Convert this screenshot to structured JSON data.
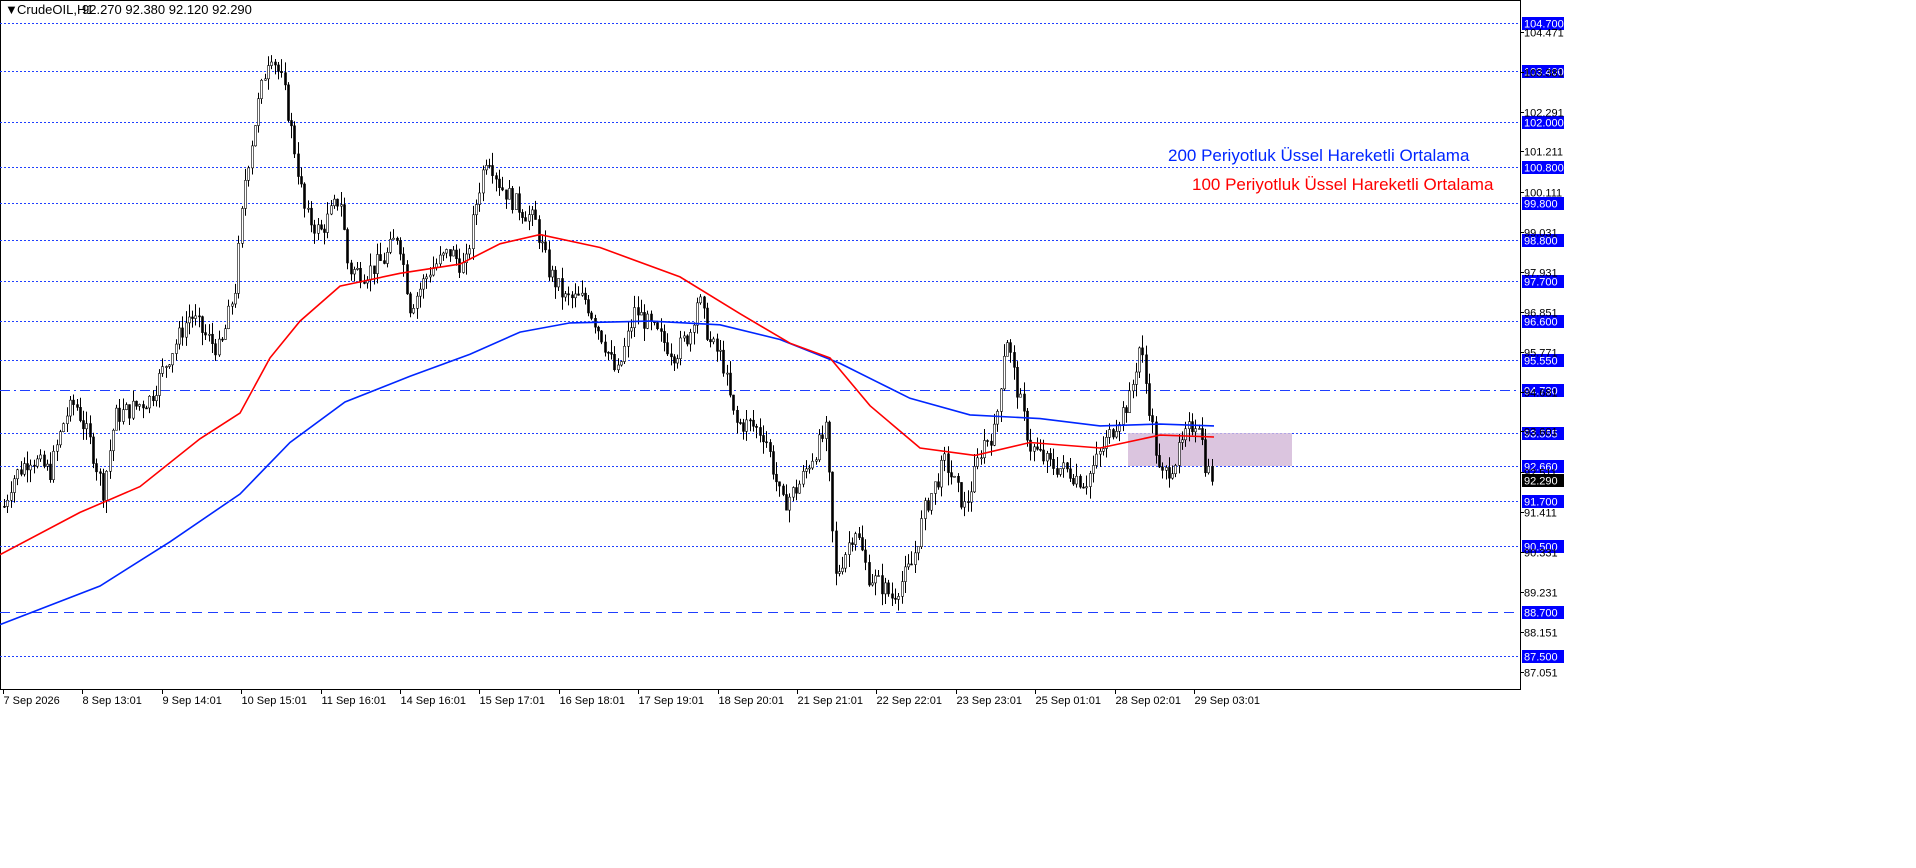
{
  "header": {
    "triangle": "▼",
    "symbol": "CrudeOIL,H1",
    "ohlc": "92.270 92.380 92.120 92.290"
  },
  "legend": {
    "ema200": "200 Periyotluk Üssel Hareketli Ortalama",
    "ema100": "100 Periyotluk Üssel Hareketli Ortalama"
  },
  "colors": {
    "background": "#ffffff",
    "candle": "#000000",
    "level_line": "#1f3fff",
    "level_label_bg": "#0000ff",
    "ema200": "#0026ff",
    "ema100": "#ff0000",
    "zone": "#d7bfdc",
    "current_price_bg": "#000000"
  },
  "chart_data": {
    "type": "candlestick",
    "symbol": "CrudeOIL",
    "timeframe": "H1",
    "ylim": [
      86.6,
      105.3
    ],
    "y_ticks": [
      "104.471",
      "103.381",
      "102.291",
      "101.211",
      "100.111",
      "99.031",
      "97.931",
      "96.851",
      "95.771",
      "94.681",
      "93.601",
      "92.511",
      "91.411",
      "90.331",
      "89.231",
      "88.151",
      "87.051"
    ],
    "x_ticks": [
      "7 Sep 2026",
      "8 Sep 13:01",
      "9 Sep 14:01",
      "10 Sep 15:01",
      "11 Sep 16:01",
      "14 Sep 16:01",
      "15 Sep 17:01",
      "16 Sep 18:01",
      "17 Sep 19:01",
      "18 Sep 20:01",
      "21 Sep 21:01",
      "22 Sep 22:01",
      "23 Sep 23:01",
      "25 Sep 01:01",
      "28 Sep 02:01",
      "29 Sep 03:01"
    ],
    "levels": [
      {
        "value": 104.7,
        "label": "104.700",
        "style": "dotted"
      },
      {
        "value": 103.4,
        "label": "103.400",
        "style": "dotted"
      },
      {
        "value": 102.0,
        "label": "102.000",
        "style": "dotted"
      },
      {
        "value": 100.8,
        "label": "100.800",
        "style": "dotted"
      },
      {
        "value": 99.8,
        "label": "99.800",
        "style": "dotted"
      },
      {
        "value": 98.8,
        "label": "98.800",
        "style": "dotted"
      },
      {
        "value": 97.7,
        "label": "97.700",
        "style": "dotted"
      },
      {
        "value": 96.6,
        "label": "96.600",
        "style": "dotted"
      },
      {
        "value": 95.55,
        "label": "95.550",
        "style": "dotted"
      },
      {
        "value": 94.73,
        "label": "94.730",
        "style": "dashdot"
      },
      {
        "value": 93.555,
        "label": "93.555",
        "style": "dotted"
      },
      {
        "value": 92.66,
        "label": "92.660",
        "style": "dotted"
      },
      {
        "value": 91.7,
        "label": "91.700",
        "style": "dotted"
      },
      {
        "value": 90.5,
        "label": "90.500",
        "style": "dotted"
      },
      {
        "value": 88.7,
        "label": "88.700",
        "style": "dashed"
      },
      {
        "value": 87.5,
        "label": "87.500",
        "style": "dotted"
      }
    ],
    "current_price": {
      "value": 92.29,
      "label": "92.290"
    },
    "zone": {
      "from_x": "28 Sep 03:01",
      "to_x": "29 Sep 09:01",
      "y_low": 92.66,
      "y_high": 93.555
    },
    "anchors": [
      {
        "x": 0,
        "p": 91.2
      },
      {
        "x": 12,
        "p": 92.3
      },
      {
        "x": 30,
        "p": 92.9
      },
      {
        "x": 50,
        "p": 92.5
      },
      {
        "x": 65,
        "p": 94.0
      },
      {
        "x": 75,
        "p": 94.4
      },
      {
        "x": 90,
        "p": 93.3
      },
      {
        "x": 103,
        "p": 92.0
      },
      {
        "x": 115,
        "p": 94.0
      },
      {
        "x": 130,
        "p": 94.2
      },
      {
        "x": 150,
        "p": 94.5
      },
      {
        "x": 170,
        "p": 95.7
      },
      {
        "x": 190,
        "p": 96.8
      },
      {
        "x": 205,
        "p": 96.2
      },
      {
        "x": 220,
        "p": 95.8
      },
      {
        "x": 235,
        "p": 97.5
      },
      {
        "x": 245,
        "p": 100.5
      },
      {
        "x": 258,
        "p": 102.5
      },
      {
        "x": 270,
        "p": 104.0
      },
      {
        "x": 283,
        "p": 103.0
      },
      {
        "x": 293,
        "p": 101.5
      },
      {
        "x": 305,
        "p": 99.5
      },
      {
        "x": 320,
        "p": 99.0
      },
      {
        "x": 340,
        "p": 100.0
      },
      {
        "x": 348,
        "p": 98.0
      },
      {
        "x": 365,
        "p": 97.9
      },
      {
        "x": 385,
        "p": 98.3
      },
      {
        "x": 398,
        "p": 99.0
      },
      {
        "x": 410,
        "p": 97.0
      },
      {
        "x": 430,
        "p": 98.0
      },
      {
        "x": 450,
        "p": 98.5
      },
      {
        "x": 465,
        "p": 98.0
      },
      {
        "x": 477,
        "p": 100.0
      },
      {
        "x": 487,
        "p": 101.2
      },
      {
        "x": 500,
        "p": 100.3
      },
      {
        "x": 515,
        "p": 99.8
      },
      {
        "x": 535,
        "p": 99.3
      },
      {
        "x": 548,
        "p": 98.0
      },
      {
        "x": 565,
        "p": 97.2
      },
      {
        "x": 585,
        "p": 97.2
      },
      {
        "x": 600,
        "p": 96.3
      },
      {
        "x": 617,
        "p": 95.1
      },
      {
        "x": 635,
        "p": 96.9
      },
      {
        "x": 655,
        "p": 96.3
      },
      {
        "x": 675,
        "p": 95.7
      },
      {
        "x": 690,
        "p": 96.3
      },
      {
        "x": 698,
        "p": 97.3
      },
      {
        "x": 710,
        "p": 96.0
      },
      {
        "x": 722,
        "p": 95.6
      },
      {
        "x": 735,
        "p": 93.8
      },
      {
        "x": 750,
        "p": 93.8
      },
      {
        "x": 765,
        "p": 93.5
      },
      {
        "x": 782,
        "p": 91.6
      },
      {
        "x": 798,
        "p": 92.1
      },
      {
        "x": 810,
        "p": 92.8
      },
      {
        "x": 826,
        "p": 93.6
      },
      {
        "x": 835,
        "p": 89.6
      },
      {
        "x": 855,
        "p": 91.0
      },
      {
        "x": 868,
        "p": 89.7
      },
      {
        "x": 882,
        "p": 89.4
      },
      {
        "x": 892,
        "p": 89.1
      },
      {
        "x": 912,
        "p": 90.0
      },
      {
        "x": 925,
        "p": 91.5
      },
      {
        "x": 945,
        "p": 92.8
      },
      {
        "x": 965,
        "p": 91.5
      },
      {
        "x": 983,
        "p": 93.3
      },
      {
        "x": 995,
        "p": 93.6
      },
      {
        "x": 1006,
        "p": 96.3
      },
      {
        "x": 1015,
        "p": 95.0
      },
      {
        "x": 1030,
        "p": 93.2
      },
      {
        "x": 1050,
        "p": 92.7
      },
      {
        "x": 1070,
        "p": 92.5
      },
      {
        "x": 1085,
        "p": 92.2
      },
      {
        "x": 1100,
        "p": 93.0
      },
      {
        "x": 1115,
        "p": 93.8
      },
      {
        "x": 1130,
        "p": 94.5
      },
      {
        "x": 1140,
        "p": 96.0
      },
      {
        "x": 1148,
        "p": 94.5
      },
      {
        "x": 1160,
        "p": 92.3
      },
      {
        "x": 1175,
        "p": 92.8
      },
      {
        "x": 1188,
        "p": 93.6
      },
      {
        "x": 1198,
        "p": 94.0
      },
      {
        "x": 1206,
        "p": 92.6
      },
      {
        "x": 1214,
        "p": 92.29
      }
    ],
    "ema200": [
      {
        "x": 0,
        "p": 88.35
      },
      {
        "x": 100,
        "p": 89.4
      },
      {
        "x": 170,
        "p": 90.6
      },
      {
        "x": 240,
        "p": 91.9
      },
      {
        "x": 290,
        "p": 93.3
      },
      {
        "x": 345,
        "p": 94.4
      },
      {
        "x": 410,
        "p": 95.1
      },
      {
        "x": 470,
        "p": 95.7
      },
      {
        "x": 520,
        "p": 96.3
      },
      {
        "x": 570,
        "p": 96.55
      },
      {
        "x": 650,
        "p": 96.6
      },
      {
        "x": 720,
        "p": 96.5
      },
      {
        "x": 780,
        "p": 96.1
      },
      {
        "x": 840,
        "p": 95.45
      },
      {
        "x": 910,
        "p": 94.5
      },
      {
        "x": 970,
        "p": 94.05
      },
      {
        "x": 1040,
        "p": 93.95
      },
      {
        "x": 1100,
        "p": 93.75
      },
      {
        "x": 1160,
        "p": 93.8
      },
      {
        "x": 1214,
        "p": 93.75
      }
    ],
    "ema100": [
      {
        "x": 0,
        "p": 90.25
      },
      {
        "x": 80,
        "p": 91.4
      },
      {
        "x": 140,
        "p": 92.1
      },
      {
        "x": 200,
        "p": 93.4
      },
      {
        "x": 240,
        "p": 94.1
      },
      {
        "x": 270,
        "p": 95.6
      },
      {
        "x": 300,
        "p": 96.6
      },
      {
        "x": 340,
        "p": 97.55
      },
      {
        "x": 400,
        "p": 97.9
      },
      {
        "x": 460,
        "p": 98.15
      },
      {
        "x": 500,
        "p": 98.7
      },
      {
        "x": 540,
        "p": 98.95
      },
      {
        "x": 600,
        "p": 98.6
      },
      {
        "x": 680,
        "p": 97.8
      },
      {
        "x": 740,
        "p": 96.8
      },
      {
        "x": 790,
        "p": 96.0
      },
      {
        "x": 830,
        "p": 95.6
      },
      {
        "x": 870,
        "p": 94.3
      },
      {
        "x": 920,
        "p": 93.15
      },
      {
        "x": 975,
        "p": 92.95
      },
      {
        "x": 1030,
        "p": 93.3
      },
      {
        "x": 1100,
        "p": 93.15
      },
      {
        "x": 1160,
        "p": 93.5
      },
      {
        "x": 1214,
        "p": 93.45
      }
    ]
  }
}
